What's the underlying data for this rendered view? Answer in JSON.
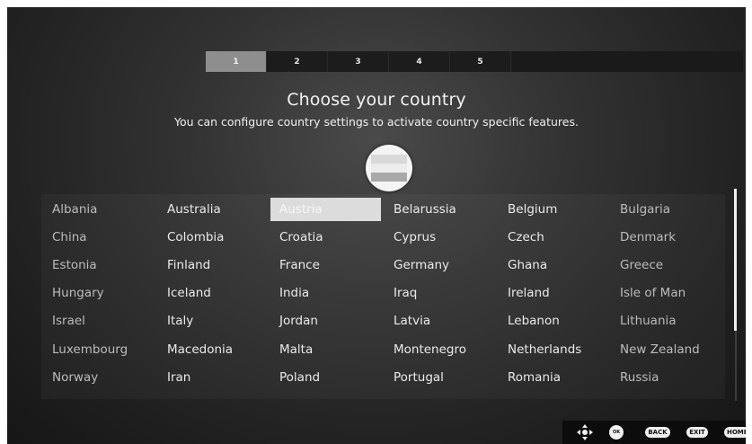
{
  "stepper": {
    "steps": [
      "1",
      "2",
      "3",
      "4",
      "5"
    ],
    "active_index": 0
  },
  "header": {
    "title": "Choose your country",
    "subtitle": "You can configure country settings to activate country specific features."
  },
  "countries": [
    [
      "Albania",
      "Australia",
      "Austria",
      "Belarussia",
      "Belgium",
      "Bulgaria"
    ],
    [
      "China",
      "Colombia",
      "Croatia",
      "Cyprus",
      "Czech",
      "Denmark"
    ],
    [
      "Estonia",
      "Finland",
      "France",
      "Germany",
      "Ghana",
      "Greece"
    ],
    [
      "Hungary",
      "Iceland",
      "India",
      "Iraq",
      "Ireland",
      "Isle of Man"
    ],
    [
      "Israel",
      "Italy",
      "Jordan",
      "Latvia",
      "Lebanon",
      "Lithuania"
    ],
    [
      "Luxembourg",
      "Macedonia",
      "Malta",
      "Montenegro",
      "Netherlands",
      "New Zealand"
    ],
    [
      "Norway",
      "Iran",
      "Poland",
      "Portugal",
      "Romania",
      "Russia"
    ]
  ],
  "selected_country": "Austria",
  "bottom_bar": {
    "ok_label": "OK",
    "back_label": "BACK",
    "exit_label": "EXIT",
    "home_label": "HOME"
  },
  "icons": {
    "nav": "dpad-arrows-icon",
    "flag": "flag-icon"
  }
}
